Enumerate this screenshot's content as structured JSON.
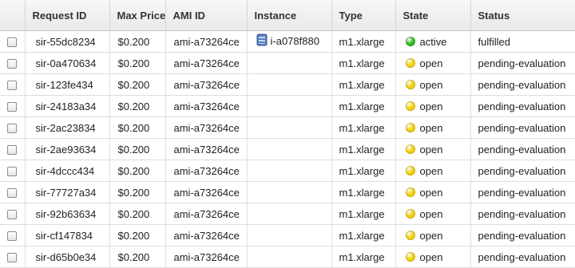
{
  "columns": [
    {
      "key": "select",
      "label": ""
    },
    {
      "key": "request_id",
      "label": "Request ID"
    },
    {
      "key": "max_price",
      "label": "Max Price"
    },
    {
      "key": "ami_id",
      "label": "AMI ID"
    },
    {
      "key": "instance",
      "label": "Instance"
    },
    {
      "key": "type",
      "label": "Type"
    },
    {
      "key": "state",
      "label": "State"
    },
    {
      "key": "status",
      "label": "Status"
    }
  ],
  "state_colors": {
    "active": "#33bb22",
    "open": "#f2d011"
  },
  "rows": [
    {
      "request_id": "sir-55dc8234",
      "max_price": "$0.200",
      "ami_id": "ami-a73264ce",
      "instance": "i-a078f880",
      "instance_icon": "instance-server-icon",
      "type": "m1.xlarge",
      "state": "active",
      "state_icon": "green-status-dot-icon",
      "status": "fulfilled"
    },
    {
      "request_id": "sir-0a470634",
      "max_price": "$0.200",
      "ami_id": "ami-a73264ce",
      "instance": "",
      "type": "m1.xlarge",
      "state": "open",
      "state_icon": "yellow-status-dot-icon",
      "status": "pending-evaluation"
    },
    {
      "request_id": "sir-123fe434",
      "max_price": "$0.200",
      "ami_id": "ami-a73264ce",
      "instance": "",
      "type": "m1.xlarge",
      "state": "open",
      "state_icon": "yellow-status-dot-icon",
      "status": "pending-evaluation"
    },
    {
      "request_id": "sir-24183a34",
      "max_price": "$0.200",
      "ami_id": "ami-a73264ce",
      "instance": "",
      "type": "m1.xlarge",
      "state": "open",
      "state_icon": "yellow-status-dot-icon",
      "status": "pending-evaluation"
    },
    {
      "request_id": "sir-2ac23834",
      "max_price": "$0.200",
      "ami_id": "ami-a73264ce",
      "instance": "",
      "type": "m1.xlarge",
      "state": "open",
      "state_icon": "yellow-status-dot-icon",
      "status": "pending-evaluation"
    },
    {
      "request_id": "sir-2ae93634",
      "max_price": "$0.200",
      "ami_id": "ami-a73264ce",
      "instance": "",
      "type": "m1.xlarge",
      "state": "open",
      "state_icon": "yellow-status-dot-icon",
      "status": "pending-evaluation"
    },
    {
      "request_id": "sir-4dccc434",
      "max_price": "$0.200",
      "ami_id": "ami-a73264ce",
      "instance": "",
      "type": "m1.xlarge",
      "state": "open",
      "state_icon": "yellow-status-dot-icon",
      "status": "pending-evaluation"
    },
    {
      "request_id": "sir-77727a34",
      "max_price": "$0.200",
      "ami_id": "ami-a73264ce",
      "instance": "",
      "type": "m1.xlarge",
      "state": "open",
      "state_icon": "yellow-status-dot-icon",
      "status": "pending-evaluation"
    },
    {
      "request_id": "sir-92b63634",
      "max_price": "$0.200",
      "ami_id": "ami-a73264ce",
      "instance": "",
      "type": "m1.xlarge",
      "state": "open",
      "state_icon": "yellow-status-dot-icon",
      "status": "pending-evaluation"
    },
    {
      "request_id": "sir-cf147834",
      "max_price": "$0.200",
      "ami_id": "ami-a73264ce",
      "instance": "",
      "type": "m1.xlarge",
      "state": "open",
      "state_icon": "yellow-status-dot-icon",
      "status": "pending-evaluation"
    },
    {
      "request_id": "sir-d65b0e34",
      "max_price": "$0.200",
      "ami_id": "ami-a73264ce",
      "instance": "",
      "type": "m1.xlarge",
      "state": "open",
      "state_icon": "yellow-status-dot-icon",
      "status": "pending-evaluation"
    }
  ]
}
